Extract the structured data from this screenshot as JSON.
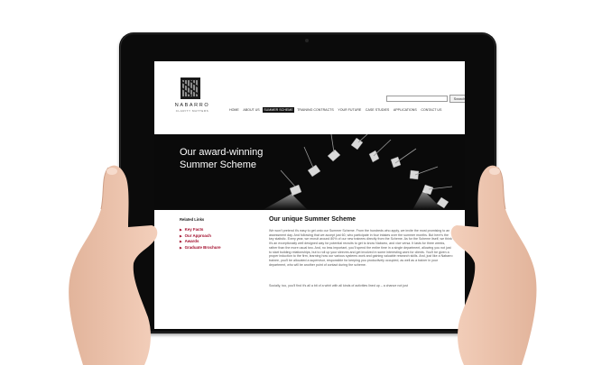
{
  "site": {
    "brand": "NABARRO",
    "tagline": "CLARITY MATTERS",
    "search_label": "Search",
    "nav": [
      {
        "label": "HOME",
        "active": false
      },
      {
        "label": "ABOUT US",
        "active": false
      },
      {
        "label": "SUMMER SCHEME",
        "active": true
      },
      {
        "label": "TRAINING CONTRACTS",
        "active": false
      },
      {
        "label": "YOUR FUTURE",
        "active": false
      },
      {
        "label": "CASE STUDIES",
        "active": false
      },
      {
        "label": "APPLICATIONS",
        "active": false
      },
      {
        "label": "CONTACT US",
        "active": false
      }
    ],
    "hero": {
      "title_line1": "Our award-winning",
      "title_line2": "Summer Scheme"
    },
    "sidebar": {
      "title": "Related Links",
      "links": [
        "Key Facts",
        "Our Approach",
        "Awards",
        "Graduate Brochure"
      ]
    },
    "main": {
      "title": "Our unique Summer Scheme",
      "paragraph1": "We won't pretend it's easy to get onto our Summer Scheme. From the hundreds who apply, we invite the most promising to an assessment day. And following that we accept just 60, who participate in four intakes over the summer months. But here's the key statistic. Every year, we recruit around 80% of our new trainees directly from the Scheme. As for the Scheme itself, we think it's an exceptionally well designed way for potential recruits to get to know Nabarro, and vice versa. It lasts for three weeks, rather than the more usual two. And, no less important, you'll spend the entire time in a single department, allowing you not just to start building relationships, but to roll up your sleeves and get involved in some interesting work for clients. You'll be given a proper induction to the firm, learning how our various systems work and gaining valuable research skills. And, just like a Nabarro trainee, you'll be allocated a supervisor, responsible for keeping you productively occupied, as well as a trainer in your department, who will be another point of contact during the scheme.",
      "paragraph2": "Socially, too, you'll find it's all a bit of a whirl with all kinds of activities lined up – a chance not just"
    }
  },
  "colors": {
    "accent": "#a20d2c",
    "hero_bg": "#0a0a0a",
    "nav_active_bg": "#111111"
  }
}
